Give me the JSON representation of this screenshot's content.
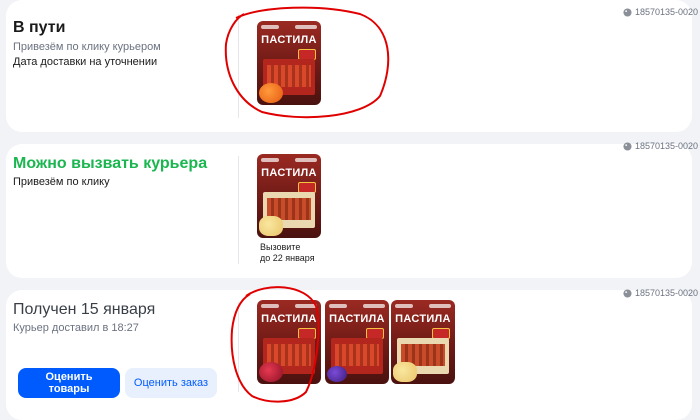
{
  "orders": [
    {
      "id": "18570135-0020",
      "status": "В пути",
      "subtitle": "Привезём по клику курьером",
      "note": "Дата доставки на уточнении",
      "products": [
        {
          "name": "ПАСТИЛА",
          "variant": "orange"
        }
      ]
    },
    {
      "id": "18570135-0020",
      "status": "Можно вызвать курьера",
      "note": "Привезём по клику",
      "products": [
        {
          "name": "ПАСТИЛА",
          "variant": "melon"
        }
      ],
      "product_caption_line1": "Вызовите",
      "product_caption_line2": "до 22 января"
    },
    {
      "id": "18570135-0020",
      "status": "Получен 15 января",
      "subtitle": "Курьер доставил в 18:27",
      "products": [
        {
          "name": "ПАСТИЛА",
          "variant": "pome"
        },
        {
          "name": "ПАСТИЛА",
          "variant": "berry"
        },
        {
          "name": "ПАСТИЛА",
          "variant": "yellow"
        }
      ],
      "buttons": {
        "rate_items": "Оценить товары",
        "rate_order": "Оценить заказ"
      }
    }
  ],
  "colors": {
    "accent_green": "#1bb650",
    "primary_blue": "#005bff",
    "annotation_red": "#e00000"
  }
}
